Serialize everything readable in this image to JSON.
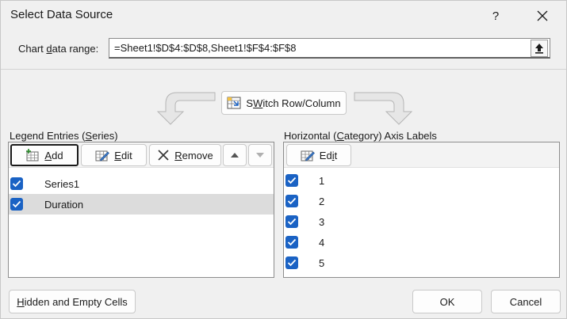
{
  "window": {
    "title": "Select Data Source",
    "help": "?",
    "close": "✕"
  },
  "range": {
    "label_pre": "Chart ",
    "label_u": "d",
    "label_post": "ata range:",
    "value": "=Sheet1!$D$4:$D$8,Sheet1!$F$4:$F$8"
  },
  "switch": {
    "u": "W",
    "pre": "S",
    "post": "itch Row/Column"
  },
  "legend": {
    "label_pre": "Legend Entries (",
    "label_u": "S",
    "label_post": "eries)",
    "add": {
      "u": "A",
      "rest": "dd"
    },
    "edit": {
      "u": "E",
      "rest": "dit"
    },
    "remove": {
      "u": "R",
      "rest": "emove"
    },
    "series": [
      {
        "name": "Series1",
        "checked": true
      },
      {
        "name": "Duration",
        "checked": true
      }
    ]
  },
  "axis": {
    "label_pre": "Horizontal (",
    "label_u": "C",
    "label_post": "ategory) Axis Labels",
    "edit": {
      "pre": "Ed",
      "u": "i",
      "post": "t"
    },
    "labels": [
      "1",
      "2",
      "3",
      "4",
      "5"
    ]
  },
  "footer": {
    "hidden": {
      "u": "H",
      "rest": "idden and Empty Cells"
    },
    "ok": "OK",
    "cancel": "Cancel"
  },
  "colors": {
    "checkbox": "#1a62c4",
    "selected_row": "#dcdcdc"
  }
}
